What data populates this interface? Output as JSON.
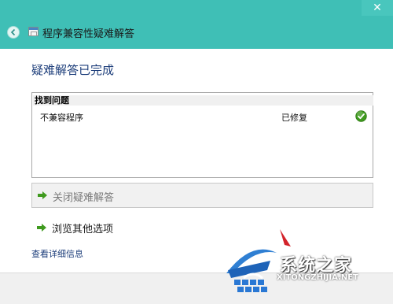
{
  "window": {
    "title": "程序兼容性疑难解答",
    "close_glyph": "✕"
  },
  "icons": {
    "back": "back-arrow-icon",
    "app": "troubleshooter-icon",
    "check": "check-icon",
    "command_arrow": "green-arrow-icon"
  },
  "content": {
    "heading": "疑难解答已完成",
    "results": {
      "header": "找到问题",
      "rows": [
        {
          "name": "不兼容程序",
          "status": "已修复"
        }
      ]
    },
    "close_command": "关闭疑难解答",
    "explore_command": "浏览其他选项",
    "details_link": "查看详细信息"
  },
  "watermark": {
    "text_cn": "系统之家",
    "text_en": "XITONGZHIJIA.NET"
  },
  "colors": {
    "titlebar": "#3fbfb6",
    "heading": "#1c3d7a",
    "link": "#1c3d7a",
    "check": "#3f9a1e"
  }
}
